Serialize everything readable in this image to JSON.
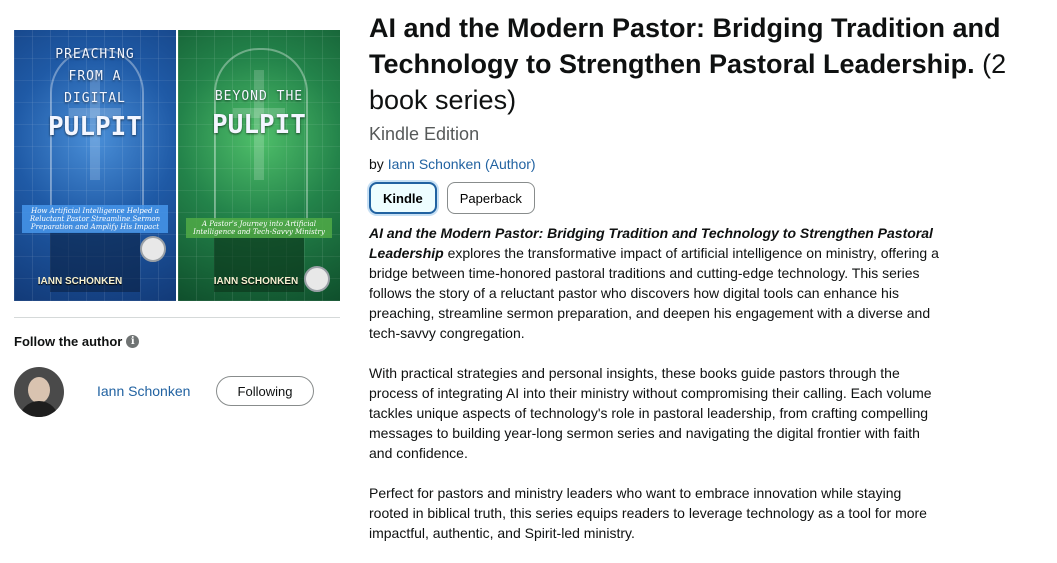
{
  "covers": [
    {
      "title_top": [
        "PREACHING",
        "FROM A",
        "DIGITAL"
      ],
      "title_big": "PULPIT",
      "subtitle": "How Artificial Intelligence Helped a Reluctant Pastor Streamline Sermon Preparation and Amplify His Impact",
      "author": "IANN SCHONKEN",
      "color": "#1f5aa6"
    },
    {
      "title_top": [
        "BEYOND THE"
      ],
      "title_big": "PULPIT",
      "subtitle": "A Pastor's Journey into Artificial Intelligence and Tech-Savvy Ministry",
      "author": "IANN SCHONKEN",
      "color": "#23834a"
    }
  ],
  "follow": {
    "label": "Follow the author",
    "info_icon": "i",
    "author_name": "Iann Schonken",
    "button_label": "Following"
  },
  "product": {
    "title_bold": "AI and the Modern Pastor: Bridging Tradition and Technology to Strengthen Pastoral Leadership.",
    "title_suffix": "(2 book series)",
    "edition": "Kindle Edition",
    "by": "by",
    "author_link": "Iann Schonken (Author)",
    "formats": [
      "Kindle",
      "Paperback"
    ],
    "selected_format": "Kindle"
  },
  "description": {
    "p1_em": "AI and the Modern Pastor: Bridging Tradition and Technology to Strengthen Pastoral Leadership",
    "p1_rest": " explores the transformative impact of artificial intelligence on ministry, offering a bridge between time-honored pastoral traditions and cutting-edge technology. This series follows the story of a reluctant pastor who discovers how digital tools can enhance his preaching, streamline sermon preparation, and deepen his engagement with a diverse and tech-savvy congregation.",
    "p2": "With practical strategies and personal insights, these books guide pastors through the process of integrating AI into their ministry without compromising their calling. Each volume tackles unique aspects of technology's role in pastoral leadership, from crafting compelling messages to building year-long sermon series and navigating the digital frontier with faith and confidence.",
    "p3": "Perfect for pastors and ministry leaders who want to embrace innovation while staying rooted in biblical truth, this series equips readers to leverage technology as a tool for more impactful, authentic, and Spirit-led ministry."
  },
  "colors": {
    "link": "#2162a1",
    "selected_border": "#2162a1",
    "muted": "#565959"
  }
}
